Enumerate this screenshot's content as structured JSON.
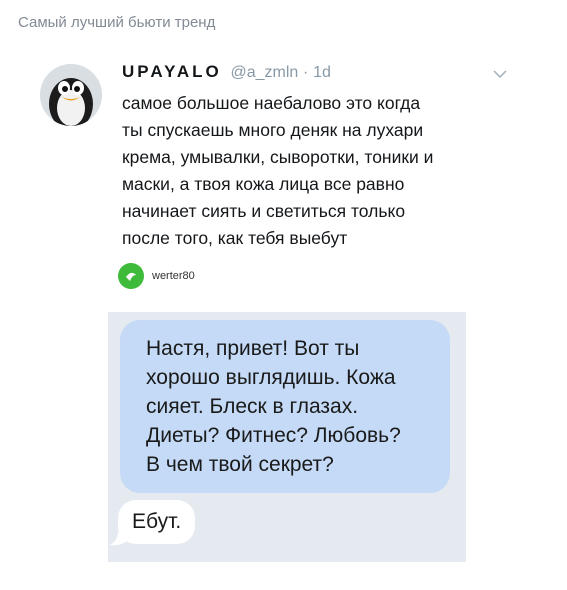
{
  "post": {
    "title": "Самый лучший бьюти тренд"
  },
  "tweet": {
    "avatar_icon": "penguin-avatar-icon",
    "display_name": "UPAYALO",
    "handle": "@a_zmln",
    "separator": "·",
    "time": "1d",
    "menu_icon": "chevron-down-icon",
    "text_lines": [
      "самое большое наебалово это когда",
      "ты спускаешь много деняк на лухари",
      "крема, умывалки, сыворотки, тоники и",
      "маски, а твоя кожа лица все равно",
      "начинает сиять и светиться только",
      "после того, как тебя выебут"
    ]
  },
  "watermark": {
    "icon": "werter-logo-icon",
    "text": "werter80"
  },
  "chat": {
    "incoming_lines": [
      "Настя, привет! Вот ты",
      "хорошо выглядишь. Кожа",
      "сияет. Блеск в глазах.",
      "Диеты? Фитнес? Любовь?",
      "В чем твой секрет?"
    ],
    "reply": "Ебут.",
    "colors": {
      "background": "#e5eaf1",
      "incoming_bubble": "#c4daf6",
      "reply_bubble": "#ffffff"
    }
  }
}
